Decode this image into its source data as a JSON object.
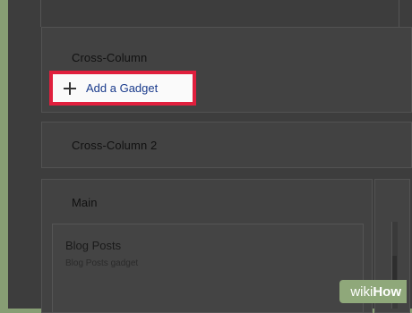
{
  "layout_sections": {
    "cross_column": {
      "title": "Cross-Column"
    },
    "add_gadget": {
      "label": "Add a Gadget",
      "highlight_color": "#e01f3d"
    },
    "cross_column_2": {
      "title": "Cross-Column 2"
    },
    "main": {
      "title": "Main"
    },
    "blog_posts_gadget": {
      "title": "Blog Posts",
      "subtitle": "Blog Posts gadget"
    }
  },
  "watermark": {
    "wiki": "wiki",
    "how": "How"
  },
  "icons": {
    "add": "plus-icon"
  }
}
